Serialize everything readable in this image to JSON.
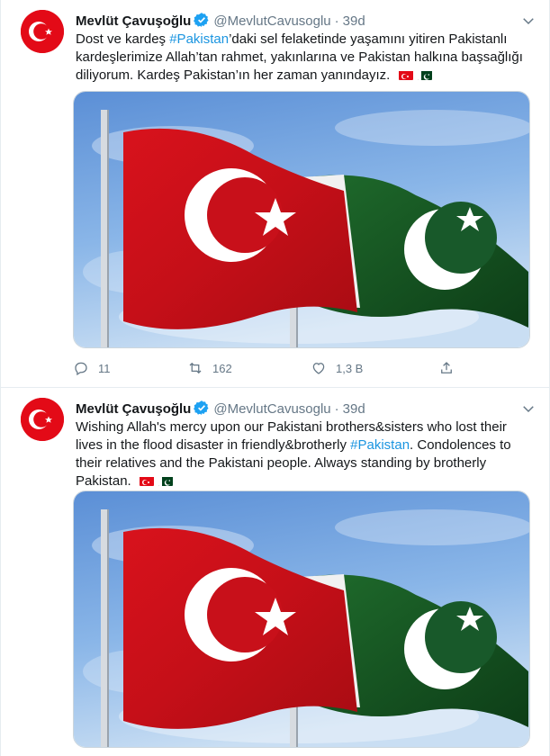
{
  "tweets": [
    {
      "author": {
        "name": "Mevlüt Çavuşoğlu",
        "handle": "@MevlutCavusoglu",
        "verified": true
      },
      "time": "39d",
      "text_parts": [
        "Dost ve kardeş ",
        "#Pakistan",
        "’daki sel felaketinde yaşamını yitiren Pakistanlı kardeşlerimize Allah’tan rahmet, yakınlarına ve Pakistan halkına başsağlığı diliyorum. Kardeş Pakistan’ın her zaman yanındayız."
      ],
      "flags": [
        "turkey-flag",
        "pakistan-flag"
      ],
      "media": "turkey-pakistan-flags-photo",
      "stats": {
        "replies": "11",
        "retweets": "162",
        "likes": "1,3 B"
      }
    },
    {
      "author": {
        "name": "Mevlüt Çavuşoğlu",
        "handle": "@MevlutCavusoglu",
        "verified": true
      },
      "time": "39d",
      "text_parts": [
        "Wishing Allah's mercy upon our Pakistani brothers&sisters who lost their lives in the flood disaster in friendly&brotherly ",
        "#Pakistan",
        ". Condolences to their relatives and the Pakistani people. Always standing by brotherly Pakistan."
      ],
      "flags": [
        "turkey-flag",
        "pakistan-flag"
      ],
      "media": "turkey-pakistan-flags-photo"
    }
  ],
  "colors": {
    "link": "#1b95e0",
    "secondary": "#657786",
    "verified": "#1da1f2",
    "turkey_red": "#e30a17",
    "pakistan_green": "#01411c"
  },
  "icons": [
    "reply-icon",
    "retweet-icon",
    "like-icon",
    "share-icon",
    "caret-down-icon",
    "verified-badge-icon"
  ]
}
